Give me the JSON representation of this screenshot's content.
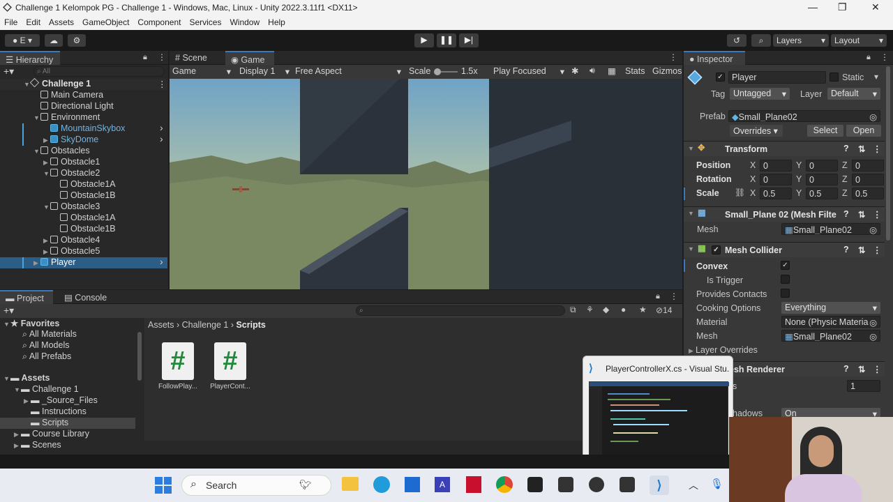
{
  "window": {
    "title": "Challenge 1 Kelompok PG - Challenge 1 - Windows, Mac, Linux - Unity 2022.3.11f1 <DX11>",
    "minimize": "—",
    "maximize": "❐",
    "close": "✕"
  },
  "menu": [
    "File",
    "Edit",
    "Assets",
    "GameObject",
    "Component",
    "Services",
    "Window",
    "Help"
  ],
  "toolbar": {
    "account": "E",
    "layers": "Layers",
    "layout": "Layout"
  },
  "hierarchy": {
    "tab": "Hierarchy",
    "search_placeholder": "All",
    "scene": "Challenge 1",
    "items": [
      {
        "label": "Main Camera",
        "indent": 1,
        "arrow": "",
        "kind": "obj"
      },
      {
        "label": "Directional Light",
        "indent": 1,
        "arrow": "",
        "kind": "obj"
      },
      {
        "label": "Environment",
        "indent": 1,
        "arrow": "▼",
        "kind": "obj"
      },
      {
        "label": "MountainSkybox",
        "indent": 2,
        "arrow": "",
        "kind": "prefab"
      },
      {
        "label": "SkyDome",
        "indent": 2,
        "arrow": "▶",
        "kind": "prefab"
      },
      {
        "label": "Obstacles",
        "indent": 1,
        "arrow": "▼",
        "kind": "obj"
      },
      {
        "label": "Obstacle1",
        "indent": 2,
        "arrow": "▶",
        "kind": "obj"
      },
      {
        "label": "Obstacle2",
        "indent": 2,
        "arrow": "▼",
        "kind": "obj"
      },
      {
        "label": "Obstacle1A",
        "indent": 3,
        "arrow": "",
        "kind": "obj"
      },
      {
        "label": "Obstacle1B",
        "indent": 3,
        "arrow": "",
        "kind": "obj"
      },
      {
        "label": "Obstacle3",
        "indent": 2,
        "arrow": "▼",
        "kind": "obj"
      },
      {
        "label": "Obstacle1A",
        "indent": 3,
        "arrow": "",
        "kind": "obj"
      },
      {
        "label": "Obstacle1B",
        "indent": 3,
        "arrow": "",
        "kind": "obj"
      },
      {
        "label": "Obstacle4",
        "indent": 2,
        "arrow": "▶",
        "kind": "obj"
      },
      {
        "label": "Obstacle5",
        "indent": 2,
        "arrow": "▶",
        "kind": "obj"
      },
      {
        "label": "Player",
        "indent": 1,
        "arrow": "▶",
        "kind": "prefab-sel"
      }
    ]
  },
  "view": {
    "tabs": [
      "Scene",
      "Game"
    ],
    "game_dropdown": "Game",
    "display": "Display 1",
    "aspect": "Free Aspect",
    "scale_label": "Scale",
    "scale_value": "1.5x",
    "play_focused": "Play Focused",
    "stats": "Stats",
    "gizmos": "Gizmos"
  },
  "project": {
    "tabs": [
      "Project",
      "Console"
    ],
    "hidden_count": "14",
    "breadcrumb": [
      "Assets",
      "Challenge 1",
      "Scripts"
    ],
    "favorites_label": "Favorites",
    "favorites": [
      "All Materials",
      "All Models",
      "All Prefabs"
    ],
    "assets_label": "Assets",
    "tree": [
      {
        "label": "Challenge 1",
        "indent": 1
      },
      {
        "label": "_Source_Files",
        "indent": 2
      },
      {
        "label": "Instructions",
        "indent": 2
      },
      {
        "label": "Scripts",
        "indent": 2,
        "selected": true
      },
      {
        "label": "Course Library",
        "indent": 1
      },
      {
        "label": "Scenes",
        "indent": 1
      }
    ],
    "files": [
      "FollowPlay...",
      "PlayerCont..."
    ],
    "file_glyph": "#"
  },
  "inspector": {
    "tab": "Inspector",
    "name": "Player",
    "static_label": "Static",
    "tag_label": "Tag",
    "tag": "Untagged",
    "layer_label": "Layer",
    "layer": "Default",
    "prefab_label": "Prefab",
    "prefab": "Small_Plane02",
    "overrides": "Overrides",
    "select": "Select",
    "open": "Open",
    "transform": {
      "title": "Transform",
      "rows": [
        {
          "label": "Position",
          "x": "0",
          "y": "0",
          "z": "0"
        },
        {
          "label": "Rotation",
          "x": "0",
          "y": "0",
          "z": "0"
        },
        {
          "label": "Scale",
          "x": "0.5",
          "y": "0.5",
          "z": "0.5"
        }
      ],
      "axis": [
        "X",
        "Y",
        "Z"
      ]
    },
    "mesh_filter": {
      "title": "Small_Plane 02 (Mesh Filte",
      "mesh_label": "Mesh",
      "mesh": "Small_Plane02"
    },
    "mesh_collider": {
      "title": "Mesh Collider",
      "convex": "Convex",
      "is_trigger": "Is Trigger",
      "provides_contacts": "Provides Contacts",
      "cooking_options": "Cooking Options",
      "cooking_value": "Everything",
      "material": "Material",
      "material_value": "None (Physic Materia",
      "mesh": "Mesh",
      "mesh_value": "Small_Plane02",
      "layer_overrides": "Layer Overrides"
    },
    "mesh_renderer": {
      "title": "esh Renderer",
      "field_value": "1",
      "field_label": "s",
      "shadows_label": "hadows",
      "shadows_value": "On"
    }
  },
  "popup": {
    "title": "PlayerControllerX.cs - Visual Stu..."
  },
  "taskbar": {
    "search": "Search"
  }
}
